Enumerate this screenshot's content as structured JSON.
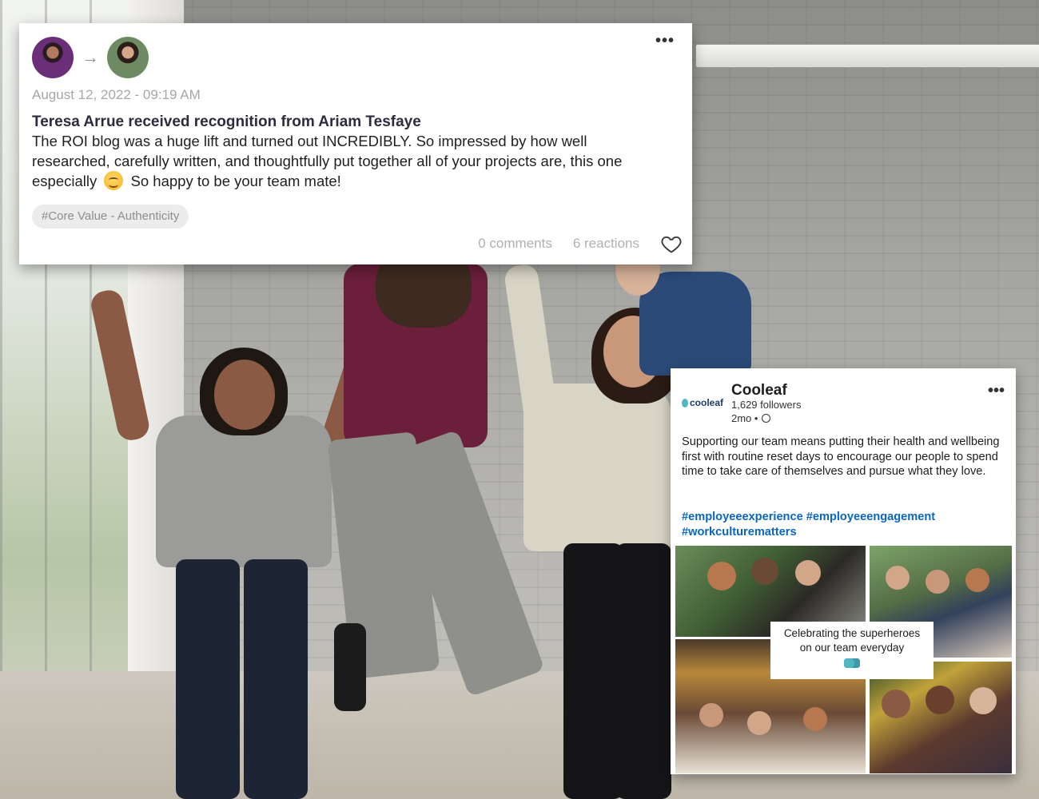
{
  "recognition": {
    "date": "August 12, 2022 - 09:19 AM",
    "title": "Teresa Arrue received recognition from Ariam Tesfaye",
    "body_before_emoji": "The ROI blog was a huge lift and turned out INCREDIBLY. So impressed by how well researched, carefully written, and thoughtfully put together all of your projects are, this one especially",
    "body_after_emoji": "So happy to be your team mate!",
    "tag": "#Core Value - Authenticity",
    "comments": "0 comments",
    "reactions": "6 reactions",
    "menu": "•••",
    "arrow": "→",
    "icons": {
      "giver": "avatar-icon",
      "receiver": "avatar-icon",
      "emoji": "smiling-face-icon",
      "like": "heart-icon"
    }
  },
  "post": {
    "logo_text": "cooleaf",
    "company": "Cooleaf",
    "followers": "1,629 followers",
    "time": "2mo •",
    "menu": "•••",
    "text": "Supporting our team means putting their health and wellbeing first with routine reset days to encourage our people to spend time to take care of themselves and pursue what they love.",
    "hashtags": "#employeeexperience #employeeengagement #workculturematters",
    "caption_line1": "Celebrating the superheroes",
    "caption_line2": "on our team everyday",
    "icons": {
      "visibility": "globe-icon",
      "brand": "cooleaf-logo-icon"
    },
    "accent_color": "#0a66c2"
  }
}
